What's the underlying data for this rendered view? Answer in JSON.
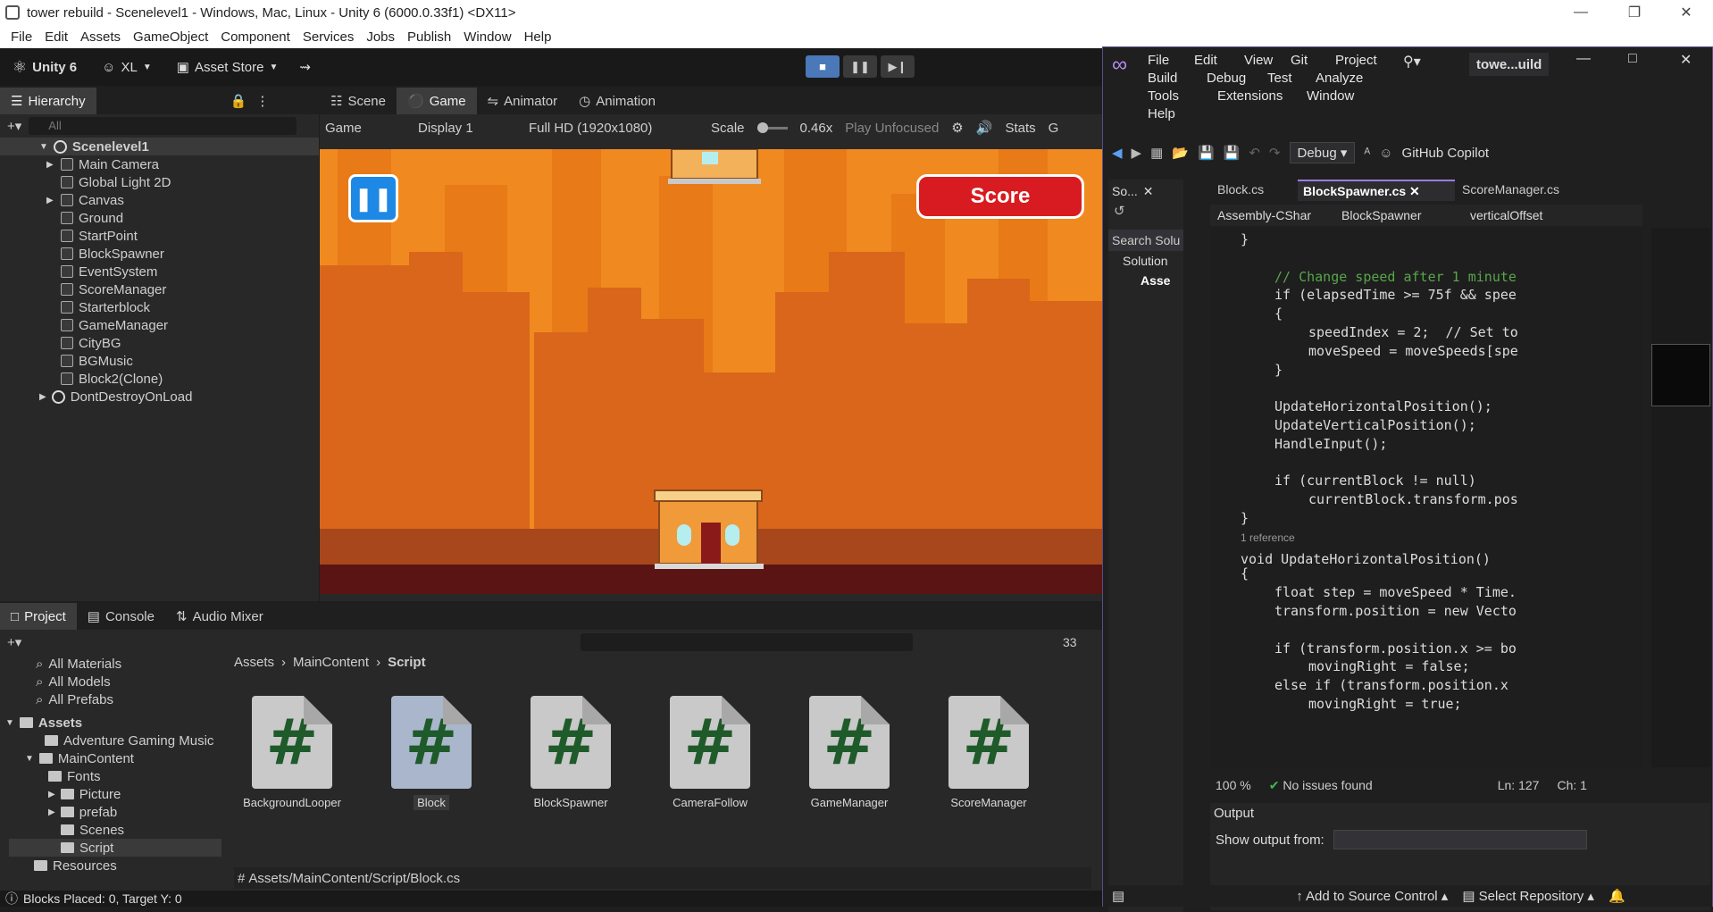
{
  "unity": {
    "title": "tower rebuild - Scenelevel1 - Windows, Mac, Linux - Unity 6 (6000.0.33f1) <DX11>",
    "menu": [
      "File",
      "Edit",
      "Assets",
      "GameObject",
      "Component",
      "Services",
      "Jobs",
      "Publish",
      "Window",
      "Help"
    ],
    "toolbar": {
      "brand": "Unity 6",
      "account": "XL",
      "asset_store": "Asset Store"
    },
    "hierarchy": {
      "tab": "Hierarchy",
      "search_placeholder": "All",
      "scene": "Scenelevel1",
      "items": [
        "Main Camera",
        "Global Light 2D",
        "Canvas",
        "Ground",
        "StartPoint",
        "BlockSpawner",
        "EventSystem",
        "ScoreManager",
        "Starterblock",
        "GameManager",
        "CityBG",
        "BGMusic",
        "Block2(Clone)"
      ],
      "dont_destroy": "DontDestroyOnLoad"
    },
    "view_tabs": [
      "Scene",
      "Game",
      "Animator",
      "Animation"
    ],
    "game_bar": {
      "mode": "Game",
      "display": "Display 1",
      "resolution": "Full HD (1920x1080)",
      "scale_label": "Scale",
      "scale_value": "0.46x",
      "play_focus": "Play Unfocused",
      "stats": "Stats",
      "gizmos": "G"
    },
    "game": {
      "score_label": "Score"
    },
    "bottom_tabs": [
      "Project",
      "Console",
      "Audio Mixer"
    ],
    "hidden_count": "33",
    "project_tree": {
      "favorites": [
        "All Materials",
        "All Models",
        "All Prefabs"
      ],
      "assets": "Assets",
      "folders": [
        "Adventure Gaming Music",
        "MainContent",
        "Fonts",
        "Picture",
        "prefab",
        "Scenes",
        "Script",
        "Resources"
      ]
    },
    "breadcrumb": [
      "Assets",
      "MainContent",
      "Script"
    ],
    "scripts": [
      "BackgroundLooper",
      "Block",
      "BlockSpawner",
      "CameraFollow",
      "GameManager",
      "ScoreManager"
    ],
    "selected_path": "Assets/MainContent/Script/Block.cs",
    "status": "Blocks Placed: 0, Target Y: 0"
  },
  "vs": {
    "menu_rows": [
      [
        "File",
        "Edit",
        "View",
        "Git",
        "Project"
      ],
      [
        "Build",
        "Debug",
        "Test",
        "Analyze"
      ],
      [
        "Tools",
        "Extensions",
        "Window"
      ],
      [
        "Help"
      ]
    ],
    "solution_name": "towe...uild",
    "config": "Debug",
    "copilot": "GitHub Copilot",
    "tabs": [
      "Block.cs",
      "BlockSpawner.cs",
      "ScoreManager.cs"
    ],
    "nav": {
      "project": "Assembly-CShar",
      "class": "BlockSpawner",
      "member": "verticalOffset"
    },
    "solution_panel": {
      "title": "So...",
      "search": "Search Solu",
      "solution": "Solution",
      "assets": "Asse"
    },
    "codelens": "1 reference",
    "status": {
      "zoom": "100 %",
      "issues": "No issues found",
      "line": "Ln: 127",
      "col": "Ch: 1"
    },
    "output": {
      "title": "Output",
      "show_from": "Show output from:"
    },
    "bottom": {
      "source_control": "Add to Source Control",
      "repo": "Select Repository"
    },
    "code_lines": [
      {
        "indent": 3,
        "text": "}"
      },
      {
        "indent": 0,
        "text": ""
      },
      {
        "indent": 4,
        "text": "// Change speed after 1 minute"
      },
      {
        "indent": 4,
        "text": "if (elapsedTime >= 75f && spee"
      },
      {
        "indent": 4,
        "text": "{"
      },
      {
        "indent": 5,
        "text": "speedIndex = 2;  // Set to"
      },
      {
        "indent": 5,
        "text": "moveSpeed = moveSpeeds[spe"
      },
      {
        "indent": 4,
        "text": "}"
      },
      {
        "indent": 0,
        "text": ""
      },
      {
        "indent": 4,
        "text": "UpdateHorizontalPosition();"
      },
      {
        "indent": 4,
        "text": "UpdateVerticalPosition();"
      },
      {
        "indent": 4,
        "text": "HandleInput();"
      },
      {
        "indent": 0,
        "text": ""
      },
      {
        "indent": 4,
        "text": "if (currentBlock != null)"
      },
      {
        "indent": 5,
        "text": "currentBlock.transform.pos"
      },
      {
        "indent": 3,
        "text": "}"
      },
      {
        "indent": 0,
        "text": ""
      },
      {
        "indent": 3,
        "text": "void UpdateHorizontalPosition()"
      },
      {
        "indent": 3,
        "text": "{"
      },
      {
        "indent": 4,
        "text": "float step = moveSpeed * Time."
      },
      {
        "indent": 4,
        "text": "transform.position = new Vecto"
      },
      {
        "indent": 0,
        "text": ""
      },
      {
        "indent": 4,
        "text": "if (transform.position.x >= bo"
      },
      {
        "indent": 5,
        "text": "movingRight = false;"
      },
      {
        "indent": 4,
        "text": "else if (transform.position.x"
      },
      {
        "indent": 5,
        "text": "movingRight = true;"
      }
    ]
  }
}
